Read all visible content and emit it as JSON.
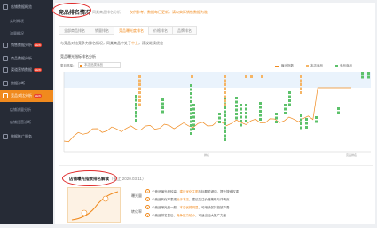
{
  "sidebar": {
    "items": [
      {
        "label": "店铺数据概览",
        "new": "",
        "type": "main",
        "top": 0
      },
      {
        "label": "实时概况",
        "new": "",
        "type": "sub",
        "top": 0
      },
      {
        "label": "流量概况",
        "new": "",
        "type": "sub",
        "top": 0
      },
      {
        "label": "销售数据分析",
        "new": "NEW",
        "type": "main",
        "top": 0
      },
      {
        "label": "商品数据分析",
        "new": "",
        "type": "main",
        "top": 0
      },
      {
        "label": "渠道营销数据",
        "new": "NEW",
        "type": "main",
        "top": 0
      },
      {
        "label": "数据诊断",
        "new": "",
        "type": "main",
        "top": 0
      },
      {
        "label": "竞品对比分析",
        "new": "NEW",
        "type": "active",
        "top": 0
      },
      {
        "label": "店铺流量分析",
        "new": "",
        "type": "sub",
        "top": 0
      },
      {
        "label": "店铺经营诊断",
        "new": "",
        "type": "sub",
        "top": 0
      },
      {
        "label": "数据推广服务",
        "new": "",
        "type": "main",
        "top": 0
      }
    ]
  },
  "header": {
    "title": "竞品排名情况",
    "subtitle": "同类商品排名分析",
    "warning": "仅供参考，数据每日更新，请以实际销售数据为准"
  },
  "tabs": [
    {
      "label": "全部商品排名",
      "active": false
    },
    {
      "label": "销量排名",
      "active": false
    },
    {
      "label": "竞品曝光度排名",
      "active": true
    },
    {
      "label": "价格排名",
      "active": false
    },
    {
      "label": "品牌排名",
      "active": false
    }
  ],
  "description": {
    "prefix": "与竞品对比竞争力排名情况，同类商品中处于",
    "highlight": "中上",
    "suffix": "，建议继续优化"
  },
  "chart": {
    "title": "竞品曝光指标排名分析",
    "select_label": "类目选择：",
    "select_value": "本店品类商品",
    "legend_line": "曝光指数",
    "legend_a": "本店商品",
    "legend_b": "竞品商品",
    "x_label": "排名",
    "x_end": "竞品排名",
    "colors": {
      "line": "#f08a1e",
      "a": "#f5b566",
      "b": "#5cc16a"
    }
  },
  "chart_data": {
    "type": "scatter",
    "series": [
      {
        "name": "曝光指数",
        "kind": "line"
      },
      {
        "name": "本店商品",
        "kind": "points"
      },
      {
        "name": "竞品商品",
        "kind": "points"
      }
    ]
  },
  "bottom": {
    "title": "店铺曝光指数排名解读",
    "date": "（截止 2020.03.11）",
    "quadrant_a": "曝光量",
    "quadrant_b": "转化率",
    "rows": [
      {
        "n": "1",
        "text": "个竞品曝光度较高，",
        "hl": "建议优化主图",
        "rest": "与标题关键词，提升搜索权重"
      },
      {
        "n": "2",
        "text": "个竞品转化率表现",
        "hl": "优于本店",
        "rest": "，建议关注价格策略与详情页"
      },
      {
        "n": "3",
        "text": "个竞品曝光度一般，",
        "hl": "本店优势明显",
        "rest": "，可继续保持投放节奏"
      },
      {
        "n": "4",
        "text": "个竞品排名靠后，",
        "hl": "竞争压力较小",
        "rest": "，可适当加大推广力度"
      }
    ]
  }
}
